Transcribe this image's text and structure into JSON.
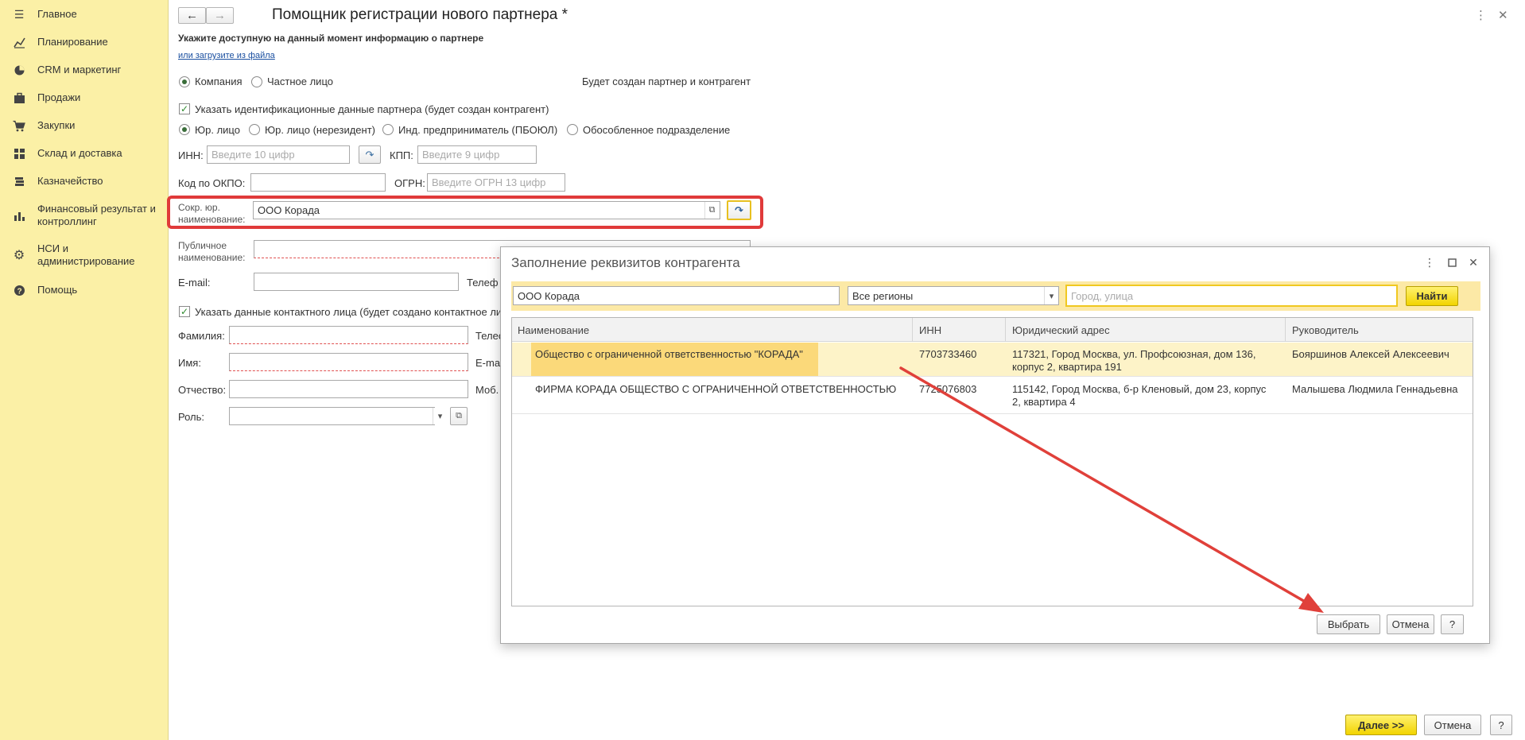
{
  "sidebar": {
    "items": [
      {
        "label": "Главное",
        "icon": "menu-icon"
      },
      {
        "label": "Планирование",
        "icon": "chart-line-icon"
      },
      {
        "label": "CRM и маркетинг",
        "icon": "pie-chart-icon"
      },
      {
        "label": "Продажи",
        "icon": "briefcase-icon"
      },
      {
        "label": "Закупки",
        "icon": "cart-icon"
      },
      {
        "label": "Склад и доставка",
        "icon": "grid-icon"
      },
      {
        "label": "Казначейство",
        "icon": "coins-icon"
      },
      {
        "label": "Финансовый результат и контроллинг",
        "icon": "bar-chart-icon"
      },
      {
        "label": "НСИ и администрирование",
        "icon": "gear-icon"
      },
      {
        "label": "Помощь",
        "icon": "help-icon"
      }
    ]
  },
  "header": {
    "title": "Помощник регистрации нового партнера *",
    "back_icon": "←",
    "forward_icon": "→",
    "more_icon": "⋮",
    "close_icon": "✕"
  },
  "form": {
    "hint": "Укажите доступную на данный момент информацию о партнере",
    "load_link": "или загрузите из файла",
    "type_company": "Компания",
    "type_person": "Частное лицо",
    "will_create": "Будет создан партнер и контрагент",
    "specify_ident": "Указать идентификационные данные партнера (будет создан контрагент)",
    "legal_entity": "Юр. лицо",
    "legal_nonresident": "Юр. лицо (нерезидент)",
    "individual_entrepreneur": "Инд. предприниматель (ПБОЮЛ)",
    "separate_division": "Обособленное подразделение",
    "inn_label": "ИНН:",
    "inn_placeholder": "Введите 10 цифр",
    "kpp_label": "КПП:",
    "kpp_placeholder": "Введите 9 цифр",
    "okpo_label": "Код по ОКПО:",
    "okpo_value": "",
    "ogrn_label": "ОГРН:",
    "ogrn_placeholder": "Введите ОГРН 13 цифр",
    "short_name_label_1": "Сокр. юр.",
    "short_name_label_2": "наименование:",
    "short_name_value": "ООО Корада",
    "public_name_label_1": "Публичное",
    "public_name_label_2": "наименование:",
    "public_name_value": "",
    "email_label": "E-mail:",
    "email_value": "",
    "phone_label_partial": "Телеф",
    "specify_contact": "Указать данные контактного лица (будет создано контактное лиц",
    "surname_label": "Фамилия:",
    "name_label": "Имя:",
    "patronymic_label": "Отчество:",
    "role_label": "Роль:",
    "contact_phone_partial": "Телес",
    "contact_email_partial": "E-ma",
    "contact_mobile_partial": "Моб."
  },
  "dialog": {
    "title": "Заполнение реквизитов контрагента",
    "search_value": "ООО Корада",
    "region_value": "Все регионы",
    "city_placeholder": "Город, улица",
    "find_label": "Найти",
    "columns": [
      "Наименование",
      "ИНН",
      "Юридический адрес",
      "Руководитель"
    ],
    "rows": [
      {
        "name": "Общество с ограниченной ответственностью \"КОРАДА\"",
        "inn": "7703733460",
        "address": "117321, Город Москва, ул. Профсоюзная, дом 136, корпус 2, квартира 191",
        "director": "Бояршинов Алексей Алексеевич"
      },
      {
        "name": "ФИРМА КОРАДА ОБЩЕСТВО С ОГРАНИЧЕННОЙ ОТВЕТСТВЕННОСТЬЮ",
        "inn": "7725076803",
        "address": "115142, Город Москва, б-р Кленовый, дом 23, корпус 2, квартира 4",
        "director": "Малышева Людмила Геннадьевна"
      }
    ],
    "select_label": "Выбрать",
    "cancel_label": "Отмена",
    "help_label": "?"
  },
  "footer": {
    "next_label": "Далее >>",
    "cancel_label": "Отмена",
    "help_label": "?"
  },
  "colors": {
    "sidebar_bg": "#fbf0a6",
    "highlight_red": "#e03a3a",
    "arrow_red": "#e0403a",
    "selected_row": "#fdf3c8",
    "accent_yellow": "#f2d400"
  }
}
